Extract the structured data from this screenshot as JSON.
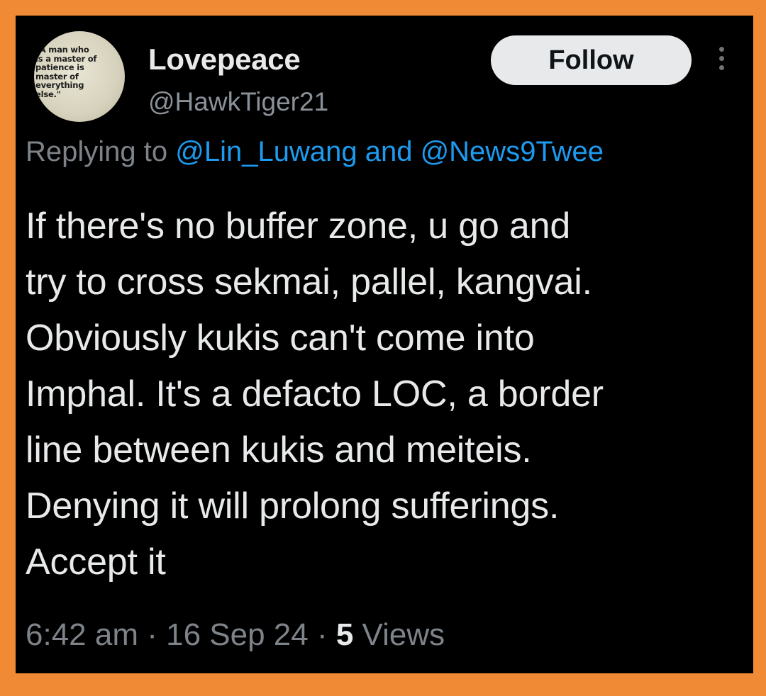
{
  "colors": {
    "frame": "#f08a34",
    "background": "#000000",
    "text": "#e7e9ea",
    "muted": "#7d8389",
    "link": "#1d9bf0",
    "follow_button_bg": "#e7e9ea"
  },
  "author": {
    "avatar_text": "\"A man who\nis a master of\npatience is\nmaster of\neverything\nelse.\"",
    "display_name": "Lovepeace",
    "handle": "@HawkTiger21"
  },
  "follow_label": "Follow",
  "more_icon": "more-vertical-icon",
  "reply": {
    "prefix": "Replying to ",
    "mention_1": "@Lin_Luwang",
    "conjunction": " and ",
    "mention_2": "@News9Twee"
  },
  "body_lines": [
    "If there's no buffer zone, u go and",
    "try to cross sekmai, pallel, kangvai.",
    "Obviously kukis can't come into",
    "Imphal. It's a defacto LOC, a border",
    "line between kukis and meiteis.",
    "Denying it will prolong sufferings.",
    "Accept it"
  ],
  "meta": {
    "time": "6:42 am",
    "separator": " · ",
    "date": "16 Sep 24",
    "views_count": "5",
    "views_label": " Views"
  }
}
